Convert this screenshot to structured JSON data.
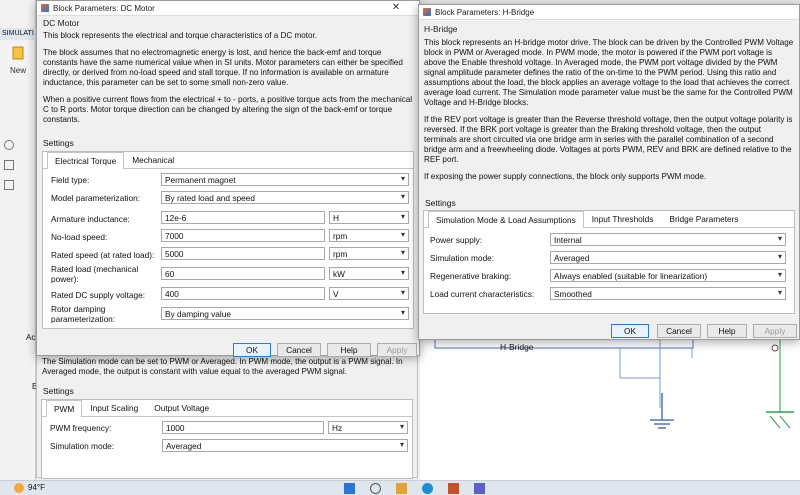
{
  "background": {
    "tab": "SIMULATI",
    "new_label": "New",
    "canvas_block_label": "H-Bridge",
    "left_labels": [
      "Ac",
      "E"
    ]
  },
  "dc_motor_dialog": {
    "title": "Block Parameters: DC Motor",
    "group": "DC Motor",
    "paragraphs": [
      "This block represents the electrical and torque characteristics of a DC motor.",
      "The block assumes that no electromagnetic energy is lost, and hence the back-emf and torque constants have the same numerical value when in SI units. Motor parameters can either be specified directly, or derived from no-load speed and stall torque. If no information is available on armature inductance, this parameter can be set to some small non-zero value.",
      "When a positive current flows from the electrical + to - ports, a positive torque acts from the mechanical C to R ports. Motor torque direction can be changed by altering the sign of the back-emf or torque constants."
    ],
    "settings_label": "Settings",
    "tabs": [
      "Electrical Torque",
      "Mechanical"
    ],
    "params": {
      "field_type": {
        "label": "Field type:",
        "value": "Permanent magnet"
      },
      "model_param": {
        "label": "Model parameterization:",
        "value": "By rated load and speed"
      },
      "inductance": {
        "label": "Armature inductance:",
        "value": "12e-6",
        "unit": "H"
      },
      "no_load": {
        "label": "No-load speed:",
        "value": "7000",
        "unit": "rpm"
      },
      "rated_speed": {
        "label": "Rated speed (at rated load):",
        "value": "5000",
        "unit": "rpm"
      },
      "rated_load_l1": "Rated load (mechanical",
      "rated_load_l2": "power):",
      "rated_load": {
        "value": "60",
        "unit": "kW"
      },
      "supply": {
        "label": "Rated DC supply voltage:",
        "value": "400",
        "unit": "V"
      },
      "damping_l1": "Rotor damping",
      "damping_l2": "parameterization:",
      "damping": {
        "value": "By damping value"
      }
    },
    "buttons": {
      "ok": "OK",
      "cancel": "Cancel",
      "help": "Help",
      "apply": "Apply"
    }
  },
  "pwm_dialog": {
    "desc": "The Simulation mode can be set to PWM or Averaged. In PWM mode, the output is a PWM signal. In Averaged mode, the output is constant with value equal to the averaged PWM signal.",
    "settings_label": "Settings",
    "tabs": [
      "PWM",
      "Input Scaling",
      "Output Voltage"
    ],
    "freq": {
      "label": "PWM frequency:",
      "value": "1000",
      "unit": "Hz"
    },
    "mode": {
      "label": "Simulation mode:",
      "value": "Averaged"
    }
  },
  "hbridge_dialog": {
    "title": "Block Parameters: H-Bridge",
    "group": "H-Bridge",
    "paragraphs": [
      "This block represents an H-bridge motor drive. The block can be driven by the Controlled PWM Voltage block in PWM or Averaged mode. In PWM mode, the motor is powered if the PWM port voltage is above the Enable threshold voltage. In Averaged mode, the PWM port voltage divided by the PWM signal amplitude parameter defines the ratio of the on-time to the PWM period. Using this ratio and assumptions about the load, the block applies an average voltage to the load that achieves the correct average load current. The Simulation mode parameter value must be the same for the Controlled PWM Voltage and H-Bridge blocks.",
      "If the REV port voltage is greater than the Reverse threshold voltage, then the output voltage polarity is reversed. If the BRK port voltage is greater than the Braking threshold voltage, then the output terminals are short circuited via one bridge arm in series with the parallel combination of a second bridge arm and a freewheeling diode. Voltages at ports PWM, REV and BRK are defined relative to the REF port.",
      "If exposing the power supply connections, the block only supports PWM mode."
    ],
    "settings_label": "Settings",
    "tabs": [
      "Simulation Mode & Load Assumptions",
      "Input Thresholds",
      "Bridge Parameters"
    ],
    "params": {
      "power": {
        "label": "Power supply:",
        "value": "Internal"
      },
      "mode": {
        "label": "Simulation mode:",
        "value": "Averaged"
      },
      "regen": {
        "label": "Regenerative braking:",
        "value": "Always enabled (suitable for linearization)"
      },
      "load": {
        "label": "Load current characteristics:",
        "value": "Smoothed"
      }
    },
    "buttons": {
      "ok": "OK",
      "cancel": "Cancel",
      "help": "Help",
      "apply": "Apply"
    }
  },
  "taskbar": {
    "weather": "94°F"
  }
}
